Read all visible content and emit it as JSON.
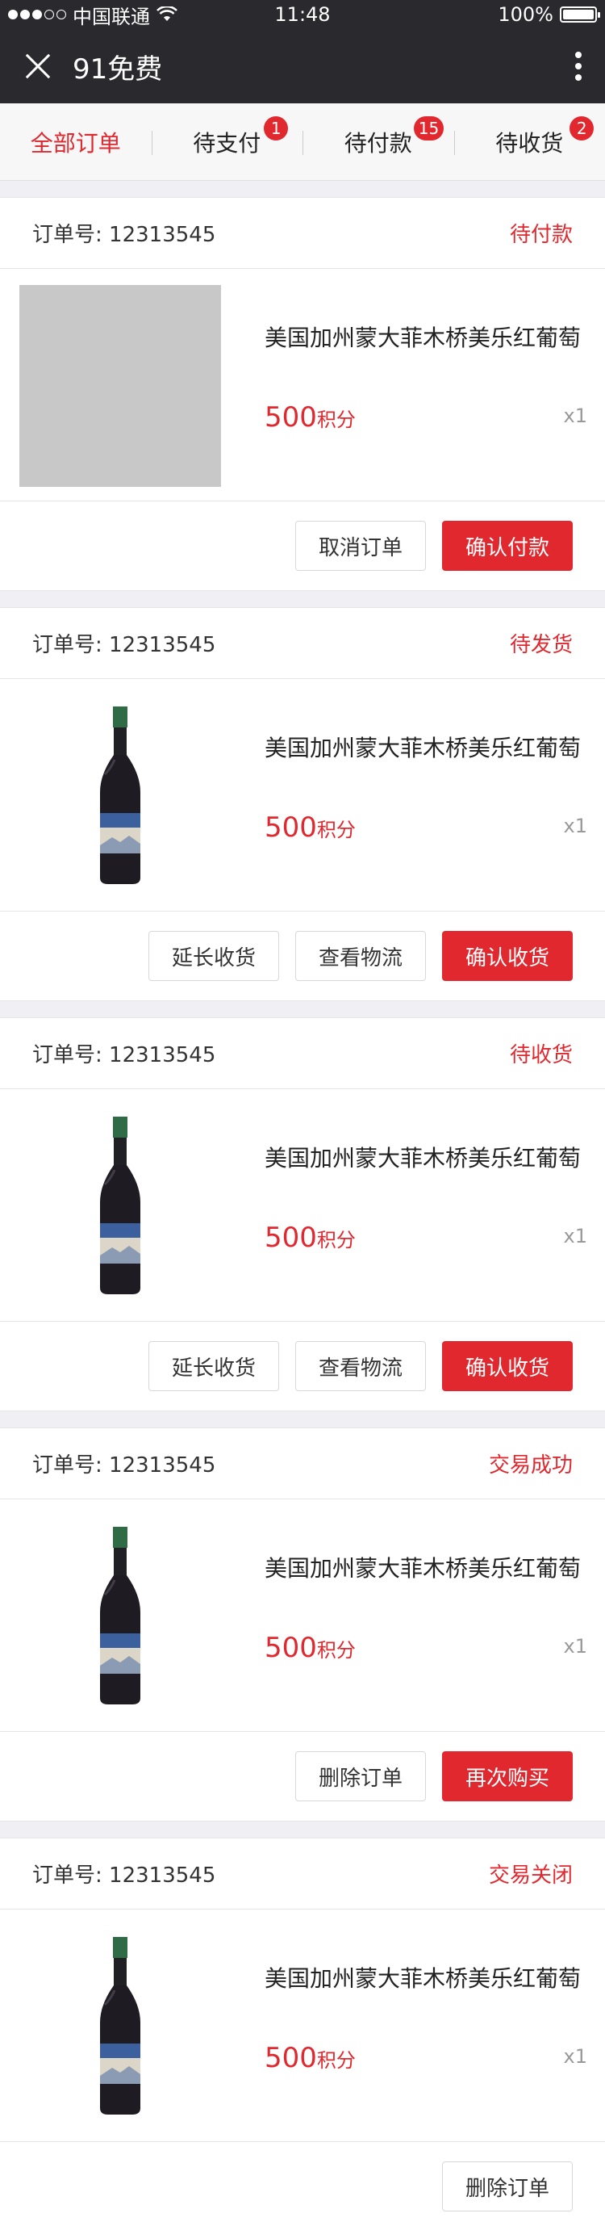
{
  "status_bar": {
    "carrier": "中国联通",
    "time": "11:48",
    "battery": "100%"
  },
  "header": {
    "title": "91免费"
  },
  "tabs": [
    {
      "label": "全部订单",
      "badge": ""
    },
    {
      "label": "待支付",
      "badge": "1"
    },
    {
      "label": "待付款",
      "badge": "15"
    },
    {
      "label": "待收货",
      "badge": "2"
    }
  ],
  "orders": [
    {
      "order_no": "订单号: 12313545",
      "status": "待付款",
      "product_name": "美国加州蒙大菲木桥美乐红葡萄",
      "price": "500",
      "price_unit": "积分",
      "qty": "x1",
      "buttons": [
        "取消订单",
        "确认付款"
      ]
    },
    {
      "order_no": "订单号: 12313545",
      "status": "待发货",
      "product_name": "美国加州蒙大菲木桥美乐红葡萄",
      "price": "500",
      "price_unit": "积分",
      "qty": "x1",
      "buttons": [
        "延长收货",
        "查看物流",
        "确认收货"
      ]
    },
    {
      "order_no": "订单号: 12313545",
      "status": "待收货",
      "product_name": "美国加州蒙大菲木桥美乐红葡萄",
      "price": "500",
      "price_unit": "积分",
      "qty": "x1",
      "buttons": [
        "延长收货",
        "查看物流",
        "确认收货"
      ]
    },
    {
      "order_no": "订单号: 12313545",
      "status": "交易成功",
      "product_name": "美国加州蒙大菲木桥美乐红葡萄",
      "price": "500",
      "price_unit": "积分",
      "qty": "x1",
      "buttons": [
        "删除订单",
        "再次购买"
      ]
    },
    {
      "order_no": "订单号: 12313545",
      "status": "交易关闭",
      "product_name": "美国加州蒙大菲木桥美乐红葡萄",
      "price": "500",
      "price_unit": "积分",
      "qty": "x1",
      "buttons": [
        "删除订单"
      ]
    }
  ],
  "colors": {
    "accent": "#e0282e",
    "header_bg": "#2a2a2e"
  }
}
